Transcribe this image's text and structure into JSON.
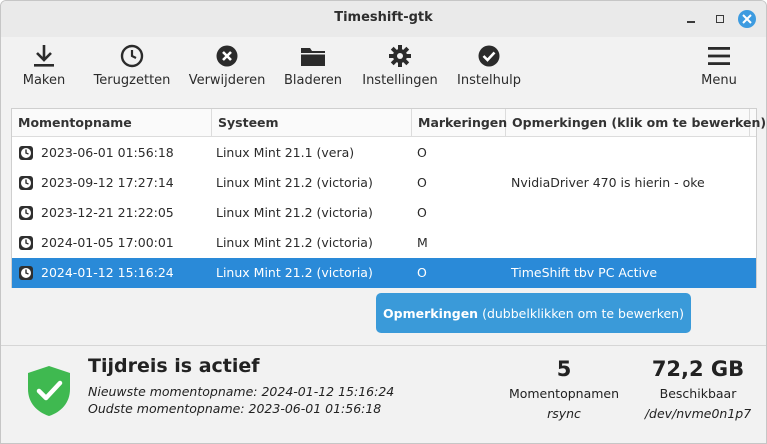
{
  "window": {
    "title": "Timeshift-gtk"
  },
  "toolbar": {
    "items": [
      {
        "label": "Maken",
        "icon": "download-icon"
      },
      {
        "label": "Terugzetten",
        "icon": "clock-icon"
      },
      {
        "label": "Verwijderen",
        "icon": "delete-icon"
      },
      {
        "label": "Bladeren",
        "icon": "folder-icon"
      },
      {
        "label": "Instellingen",
        "icon": "gear-icon"
      },
      {
        "label": "Instelhulp",
        "icon": "check-icon"
      },
      {
        "label": "Menu",
        "icon": "hamburger-icon"
      }
    ]
  },
  "table": {
    "headers": [
      "Momentopname",
      "Systeem",
      "Markeringen",
      "Opmerkingen (klik om te bewerken)"
    ],
    "rows": [
      {
        "name": "2023-06-01 01:56:18",
        "system": "Linux Mint 21.1 (vera)",
        "tag": "O",
        "note": ""
      },
      {
        "name": "2023-09-12 17:27:14",
        "system": "Linux Mint 21.2 (victoria)",
        "tag": "O",
        "note": "NvidiaDriver 470 is hierin - oke"
      },
      {
        "name": "2023-12-21 21:22:05",
        "system": "Linux Mint 21.2 (victoria)",
        "tag": "O",
        "note": ""
      },
      {
        "name": "2024-01-05 17:00:01",
        "system": "Linux Mint 21.2 (victoria)",
        "tag": "M",
        "note": ""
      },
      {
        "name": "2024-01-12 15:16:24",
        "system": "Linux Mint 21.2 (victoria)",
        "tag": "O",
        "note": "TimeShift tbv PC Active"
      }
    ],
    "selected_row": "2024-01-12 15:16:24"
  },
  "notes_button": {
    "bold": "Opmerkingen",
    "rest": "(dubbelklikken om te bewerken)"
  },
  "status": {
    "title": "Tijdreis is actief",
    "newest": "Nieuwste momentopname: 2024-01-12 15:16:24",
    "oldest": "Oudste momentopname: 2023-06-01 01:56:18",
    "count": "5",
    "count_label": "Momentopnamen",
    "count_sub": "rsync",
    "free": "72,2 GB",
    "free_label": "Beschikbaar",
    "free_sub": "/dev/nvme0n1p7"
  },
  "colors": {
    "accent": "#2a8ad8",
    "button": "#3a9ad9",
    "shield": "#3fb950"
  }
}
